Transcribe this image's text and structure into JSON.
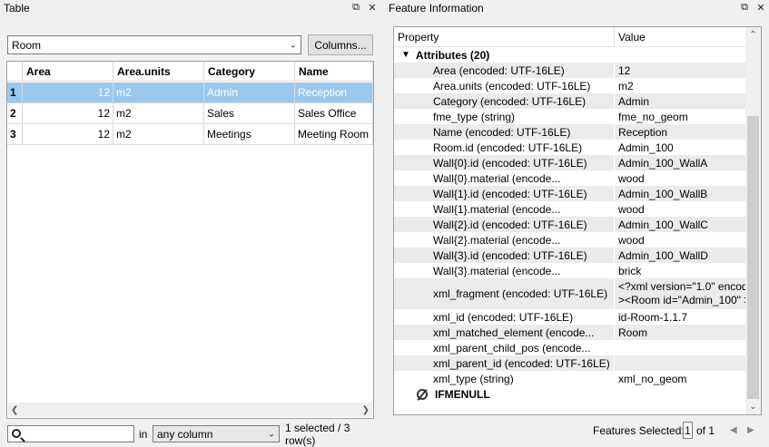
{
  "table_panel": {
    "title": "Table",
    "dataset_select": "Room",
    "columns_button": "Columns...",
    "columns": [
      "Area",
      "Area.units",
      "Category",
      "Name"
    ],
    "rows": [
      {
        "num": "1",
        "area": "12",
        "units": "m2",
        "category": "Admin",
        "name": "Reception",
        "selected": true
      },
      {
        "num": "2",
        "area": "12",
        "units": "m2",
        "category": "Sales",
        "name": "Sales Office",
        "selected": false
      },
      {
        "num": "3",
        "area": "12",
        "units": "m2",
        "category": "Meetings",
        "name": "Meeting Room",
        "selected": false
      }
    ],
    "search_value": "",
    "in_label": "in",
    "column_select": "any column",
    "status": "1 selected / 3 row(s)"
  },
  "feature_panel": {
    "title": "Feature Information",
    "header_property": "Property",
    "header_value": "Value",
    "group_label": "Attributes (20)",
    "attributes": [
      {
        "property": "Area (encoded: UTF-16LE)",
        "value": "12"
      },
      {
        "property": "Area.units (encoded: UTF-16LE)",
        "value": "m2"
      },
      {
        "property": "Category (encoded: UTF-16LE)",
        "value": "Admin"
      },
      {
        "property": "fme_type (string)",
        "value": "fme_no_geom"
      },
      {
        "property": "Name (encoded: UTF-16LE)",
        "value": "Reception"
      },
      {
        "property": "Room.id (encoded: UTF-16LE)",
        "value": "Admin_100"
      },
      {
        "property": "Wall{0}.id (encoded: UTF-16LE)",
        "value": "Admin_100_WallA"
      },
      {
        "property": "Wall{0}.material (encode...",
        "value": "wood"
      },
      {
        "property": "Wall{1}.id (encoded: UTF-16LE)",
        "value": "Admin_100_WallB"
      },
      {
        "property": "Wall{1}.material (encode...",
        "value": "wood"
      },
      {
        "property": "Wall{2}.id (encoded: UTF-16LE)",
        "value": "Admin_100_WallC"
      },
      {
        "property": "Wall{2}.material (encode...",
        "value": "wood"
      },
      {
        "property": "Wall{3}.id (encoded: UTF-16LE)",
        "value": "Admin_100_WallD"
      },
      {
        "property": "Wall{3}.material (encode...",
        "value": "brick"
      },
      {
        "property": "xml_fragment (encoded: UTF-16LE)",
        "value": "<?xml version=\"1.0\" encodi",
        "value2": "><Room id=\"Admin_100\" >"
      },
      {
        "property": "xml_id (encoded: UTF-16LE)",
        "value": "id-Room-1.1.7"
      },
      {
        "property": "xml_matched_element (encode...",
        "value": "Room"
      },
      {
        "property": "xml_parent_child_pos (encode...",
        "value": ""
      },
      {
        "property": "xml_parent_id (encoded: UTF-16LE)",
        "value": ""
      },
      {
        "property": "xml_type (string)",
        "value": "xml_no_geom"
      }
    ],
    "geometry_label": "IFMENULL",
    "features_selected_label": "Features Selected:",
    "current_page": "1",
    "of_label": "of 1"
  },
  "colors": {
    "selection": "#99c9ef",
    "alt_row": "#ebebeb"
  }
}
